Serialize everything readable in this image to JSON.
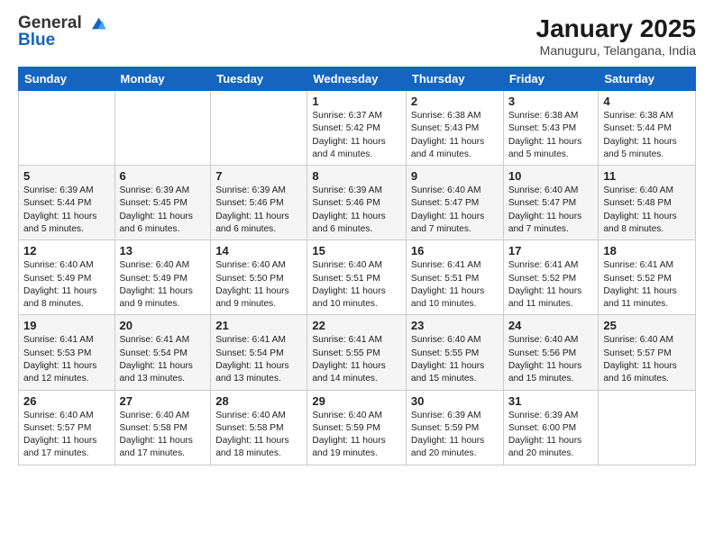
{
  "logo": {
    "line1": "General",
    "line2": "Blue"
  },
  "header": {
    "month": "January 2025",
    "location": "Manuguru, Telangana, India"
  },
  "weekdays": [
    "Sunday",
    "Monday",
    "Tuesday",
    "Wednesday",
    "Thursday",
    "Friday",
    "Saturday"
  ],
  "weeks": [
    [
      {
        "day": "",
        "info": ""
      },
      {
        "day": "",
        "info": ""
      },
      {
        "day": "",
        "info": ""
      },
      {
        "day": "1",
        "info": "Sunrise: 6:37 AM\nSunset: 5:42 PM\nDaylight: 11 hours\nand 4 minutes."
      },
      {
        "day": "2",
        "info": "Sunrise: 6:38 AM\nSunset: 5:43 PM\nDaylight: 11 hours\nand 4 minutes."
      },
      {
        "day": "3",
        "info": "Sunrise: 6:38 AM\nSunset: 5:43 PM\nDaylight: 11 hours\nand 5 minutes."
      },
      {
        "day": "4",
        "info": "Sunrise: 6:38 AM\nSunset: 5:44 PM\nDaylight: 11 hours\nand 5 minutes."
      }
    ],
    [
      {
        "day": "5",
        "info": "Sunrise: 6:39 AM\nSunset: 5:44 PM\nDaylight: 11 hours\nand 5 minutes."
      },
      {
        "day": "6",
        "info": "Sunrise: 6:39 AM\nSunset: 5:45 PM\nDaylight: 11 hours\nand 6 minutes."
      },
      {
        "day": "7",
        "info": "Sunrise: 6:39 AM\nSunset: 5:46 PM\nDaylight: 11 hours\nand 6 minutes."
      },
      {
        "day": "8",
        "info": "Sunrise: 6:39 AM\nSunset: 5:46 PM\nDaylight: 11 hours\nand 6 minutes."
      },
      {
        "day": "9",
        "info": "Sunrise: 6:40 AM\nSunset: 5:47 PM\nDaylight: 11 hours\nand 7 minutes."
      },
      {
        "day": "10",
        "info": "Sunrise: 6:40 AM\nSunset: 5:47 PM\nDaylight: 11 hours\nand 7 minutes."
      },
      {
        "day": "11",
        "info": "Sunrise: 6:40 AM\nSunset: 5:48 PM\nDaylight: 11 hours\nand 8 minutes."
      }
    ],
    [
      {
        "day": "12",
        "info": "Sunrise: 6:40 AM\nSunset: 5:49 PM\nDaylight: 11 hours\nand 8 minutes."
      },
      {
        "day": "13",
        "info": "Sunrise: 6:40 AM\nSunset: 5:49 PM\nDaylight: 11 hours\nand 9 minutes."
      },
      {
        "day": "14",
        "info": "Sunrise: 6:40 AM\nSunset: 5:50 PM\nDaylight: 11 hours\nand 9 minutes."
      },
      {
        "day": "15",
        "info": "Sunrise: 6:40 AM\nSunset: 5:51 PM\nDaylight: 11 hours\nand 10 minutes."
      },
      {
        "day": "16",
        "info": "Sunrise: 6:41 AM\nSunset: 5:51 PM\nDaylight: 11 hours\nand 10 minutes."
      },
      {
        "day": "17",
        "info": "Sunrise: 6:41 AM\nSunset: 5:52 PM\nDaylight: 11 hours\nand 11 minutes."
      },
      {
        "day": "18",
        "info": "Sunrise: 6:41 AM\nSunset: 5:52 PM\nDaylight: 11 hours\nand 11 minutes."
      }
    ],
    [
      {
        "day": "19",
        "info": "Sunrise: 6:41 AM\nSunset: 5:53 PM\nDaylight: 11 hours\nand 12 minutes."
      },
      {
        "day": "20",
        "info": "Sunrise: 6:41 AM\nSunset: 5:54 PM\nDaylight: 11 hours\nand 13 minutes."
      },
      {
        "day": "21",
        "info": "Sunrise: 6:41 AM\nSunset: 5:54 PM\nDaylight: 11 hours\nand 13 minutes."
      },
      {
        "day": "22",
        "info": "Sunrise: 6:41 AM\nSunset: 5:55 PM\nDaylight: 11 hours\nand 14 minutes."
      },
      {
        "day": "23",
        "info": "Sunrise: 6:40 AM\nSunset: 5:55 PM\nDaylight: 11 hours\nand 15 minutes."
      },
      {
        "day": "24",
        "info": "Sunrise: 6:40 AM\nSunset: 5:56 PM\nDaylight: 11 hours\nand 15 minutes."
      },
      {
        "day": "25",
        "info": "Sunrise: 6:40 AM\nSunset: 5:57 PM\nDaylight: 11 hours\nand 16 minutes."
      }
    ],
    [
      {
        "day": "26",
        "info": "Sunrise: 6:40 AM\nSunset: 5:57 PM\nDaylight: 11 hours\nand 17 minutes."
      },
      {
        "day": "27",
        "info": "Sunrise: 6:40 AM\nSunset: 5:58 PM\nDaylight: 11 hours\nand 17 minutes."
      },
      {
        "day": "28",
        "info": "Sunrise: 6:40 AM\nSunset: 5:58 PM\nDaylight: 11 hours\nand 18 minutes."
      },
      {
        "day": "29",
        "info": "Sunrise: 6:40 AM\nSunset: 5:59 PM\nDaylight: 11 hours\nand 19 minutes."
      },
      {
        "day": "30",
        "info": "Sunrise: 6:39 AM\nSunset: 5:59 PM\nDaylight: 11 hours\nand 20 minutes."
      },
      {
        "day": "31",
        "info": "Sunrise: 6:39 AM\nSunset: 6:00 PM\nDaylight: 11 hours\nand 20 minutes."
      },
      {
        "day": "",
        "info": ""
      }
    ]
  ]
}
